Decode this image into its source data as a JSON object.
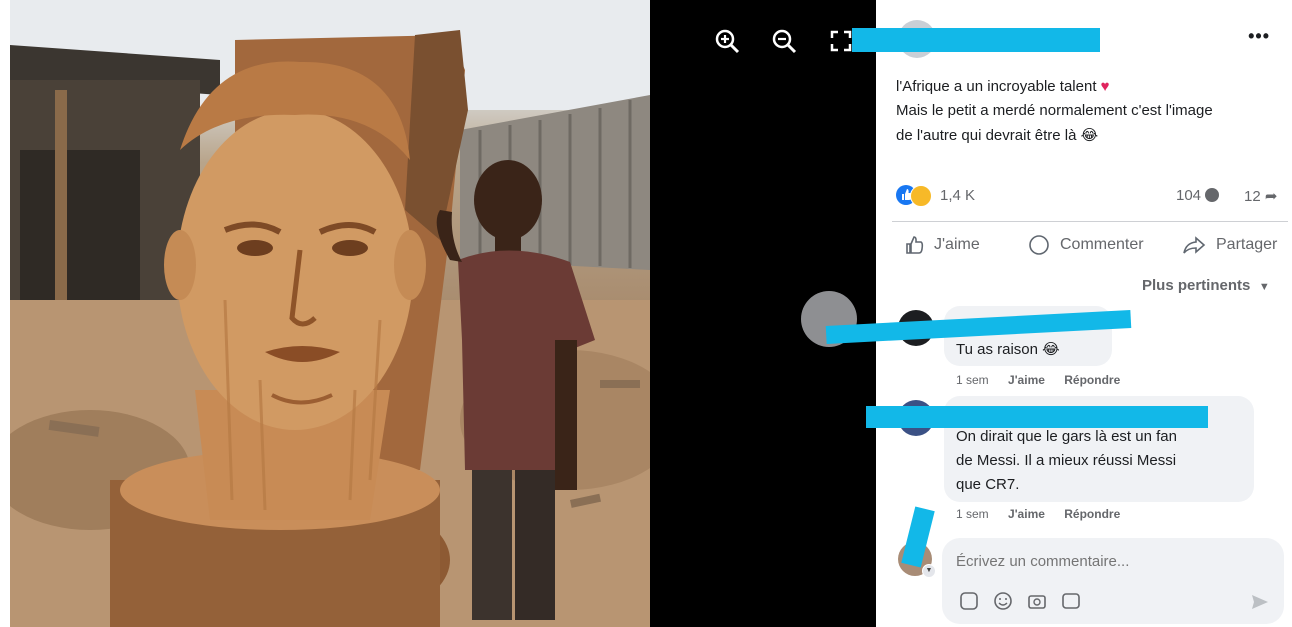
{
  "viewer": {
    "zoom_in_icon": "zoom-in-icon",
    "zoom_out_icon": "zoom-out-icon",
    "fullscreen_icon": "fullscreen-icon"
  },
  "post": {
    "caption_line1": "l'Afrique a un incroyable talent",
    "caption_line2": "Mais le petit a merdé normalement c'est l'image",
    "caption_line3": "de l'autre qui devrait être là",
    "reaction_count": "1,4 K",
    "comment_count": "104",
    "share_count": "12",
    "more_icon": "•••"
  },
  "actions": {
    "like": "J'aime",
    "comment": "Commenter",
    "share": "Partager"
  },
  "sort_label": "Plus pertinents",
  "comments": [
    {
      "text": "Tu as raison 😂",
      "time": "1 sem",
      "like": "J'aime",
      "reply": "Répondre"
    },
    {
      "line1": "On dirait que le gars là est un fan",
      "line2": "de Messi. Il a mieux réussi Messi",
      "line3": "que CR7.",
      "time": "1 sem",
      "like": "J'aime",
      "reply": "Répondre"
    }
  ],
  "composer": {
    "placeholder": "Écrivez un commentaire..."
  },
  "colors": {
    "redaction": "#12b8e8",
    "like_blue": "#1877f2",
    "haha_yellow": "#f7b928"
  }
}
